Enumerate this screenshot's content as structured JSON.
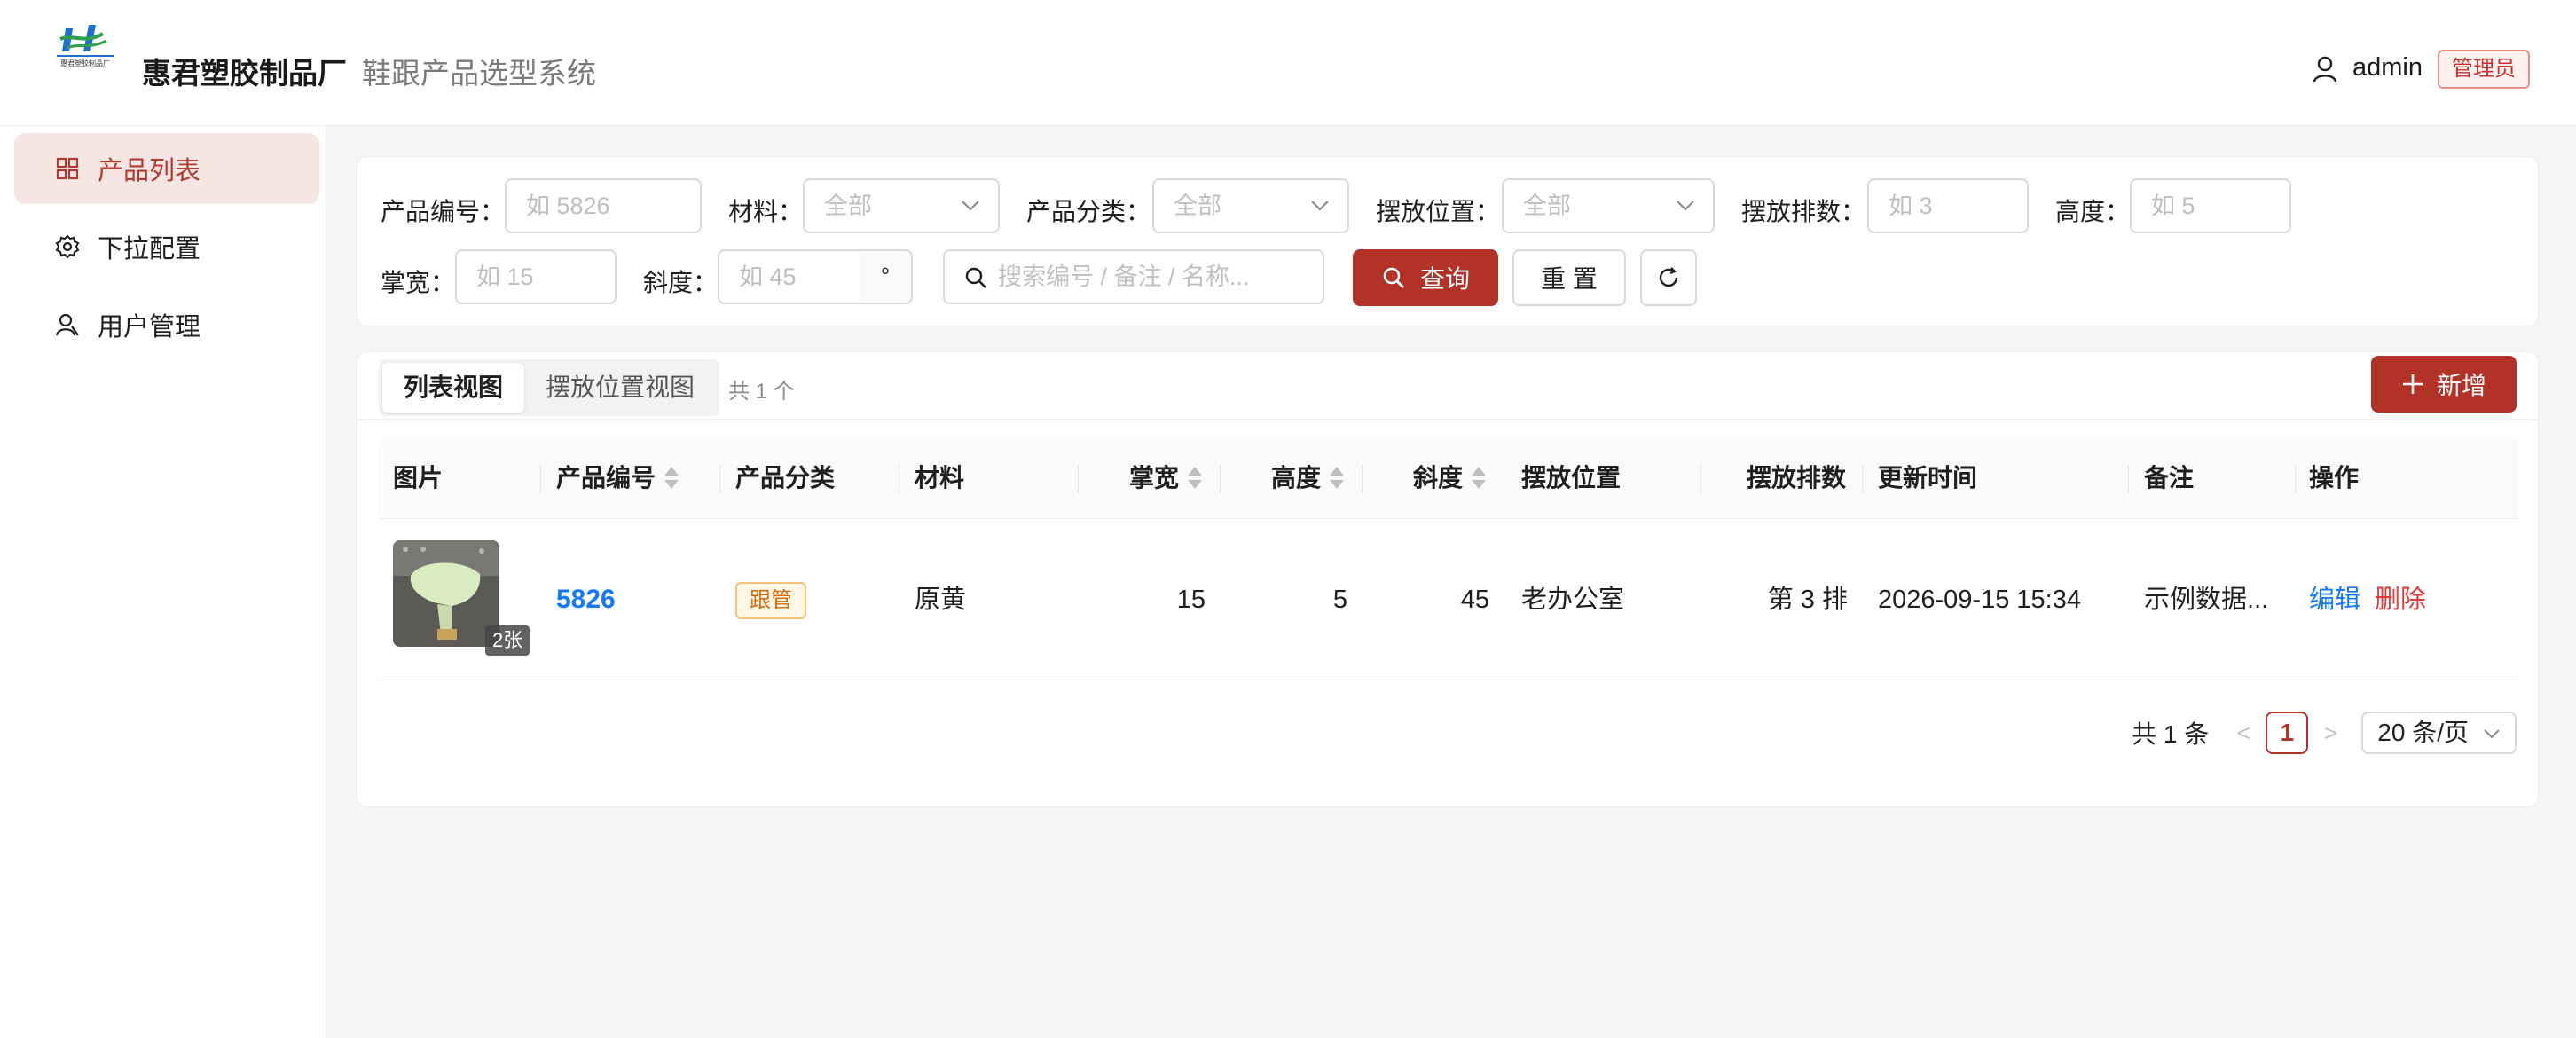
{
  "header": {
    "company": "惠君塑胶制品厂",
    "system": "鞋跟产品选型系统",
    "username": "admin",
    "role": "管理员",
    "logo_text": "惠君塑胶制品厂"
  },
  "sidebar": {
    "items": [
      {
        "label": "产品列表",
        "icon": "grid-icon",
        "active": true
      },
      {
        "label": "下拉配置",
        "icon": "gear-icon",
        "active": false
      },
      {
        "label": "用户管理",
        "icon": "users-icon",
        "active": false
      }
    ]
  },
  "filters": {
    "code_label": "产品编号：",
    "code_placeholder": "如 5826",
    "material_label": "材料：",
    "material_value": "全部",
    "category_label": "产品分类：",
    "category_value": "全部",
    "location_label": "摆放位置：",
    "location_value": "全部",
    "rows_label": "摆放排数：",
    "rows_placeholder": "如 3",
    "height_label": "高度：",
    "height_placeholder": "如 5",
    "width_label": "掌宽：",
    "width_placeholder": "如 15",
    "slope_label": "斜度：",
    "slope_placeholder": "如 45",
    "slope_unit": "°",
    "keyword_placeholder": "搜索编号 / 备注 / 名称...",
    "query_label": "查询",
    "reset_label": "重 置"
  },
  "toolbar": {
    "view_list": "列表视图",
    "view_location": "摆放位置视图",
    "count_text": "共 1 个",
    "add_label": "新增"
  },
  "table": {
    "columns": [
      "图片",
      "产品编号",
      "产品分类",
      "材料",
      "掌宽",
      "高度",
      "斜度",
      "摆放位置",
      "摆放排数",
      "更新时间",
      "备注",
      "操作"
    ],
    "rows": [
      {
        "image_count": "2张",
        "code": "5826",
        "category": "跟管",
        "material": "原黄",
        "width": "15",
        "height": "5",
        "slope": "45",
        "location": "老办公室",
        "rows": "第 3 排",
        "updated": "2026-09-15 15:34",
        "remark": "示例数据...",
        "edit": "编辑",
        "delete": "删除"
      }
    ]
  },
  "pagination": {
    "total_text": "共 1 条",
    "prev": "<",
    "current": "1",
    "next": ">",
    "page_size": "20 条/页"
  },
  "colors": {
    "primary": "#b33228",
    "link": "#1677ff",
    "danger": "#e03a3a",
    "tag_orange": "#d46b08"
  }
}
